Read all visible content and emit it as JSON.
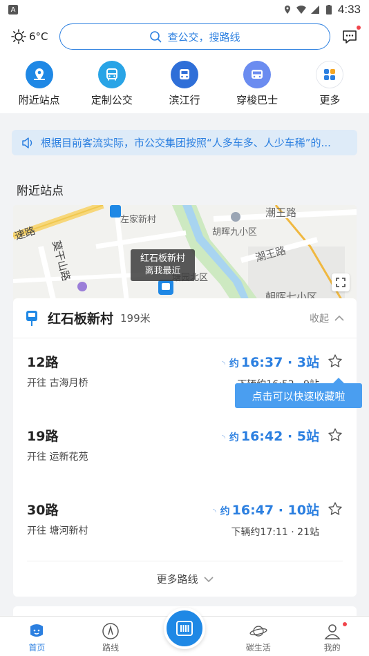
{
  "status_bar": {
    "left_badge": "A",
    "time": "4:33"
  },
  "top_bar": {
    "temperature": "6°C",
    "search_placeholder": "查公交，搜路线"
  },
  "quick_nav": [
    {
      "label": "附近站点",
      "icon": "map-pin-icon",
      "color": "#1f88e5"
    },
    {
      "label": "定制公交",
      "icon": "bus-icon",
      "color": "#29a4e6"
    },
    {
      "label": "滨江行",
      "icon": "bus-front-icon",
      "color": "#2f6fd8"
    },
    {
      "label": "穿梭巴士",
      "icon": "shuttle-bus-icon",
      "color": "#6b8cf0"
    },
    {
      "label": "更多",
      "icon": "grid-icon",
      "color": "#f0f3f8"
    }
  ],
  "notice": {
    "text": "根据目前客流实际，市公交集团按照“人多车多、人少车稀”的..."
  },
  "nearby_title": "附近站点",
  "map": {
    "tooltip_line1": "红石板新村",
    "tooltip_line2": "离我最近",
    "labels": [
      "左家新村",
      "胡晖九小区",
      "潮王路",
      "潮王路",
      "速路",
      "莫干山路",
      "塘园北区",
      "朝晖七小区"
    ]
  },
  "station": {
    "name": "红石板新村",
    "distance": "199米",
    "collapse_label": "收起",
    "routes": [
      {
        "name": "12路",
        "dest": "开往 古海月桥",
        "approx": "约",
        "eta": "16:37 · 3站",
        "next": "下辆约16:52 · 9站"
      },
      {
        "name": "19路",
        "dest": "开往 运新花苑",
        "approx": "约",
        "eta": "16:42 · 5站",
        "next": ""
      },
      {
        "name": "30路",
        "dest": "开往 塘河新村",
        "approx": "约",
        "eta": "16:47 · 10站",
        "next": "下辆约17:11 · 21站"
      }
    ],
    "more_routes": "更多路线"
  },
  "tip": "点击可以快速收藏啦",
  "tabs": [
    {
      "label": "首页",
      "active": true
    },
    {
      "label": "路线",
      "active": false
    },
    {
      "label": "",
      "active": false
    },
    {
      "label": "碳生活",
      "active": false
    },
    {
      "label": "我的",
      "active": false
    }
  ],
  "colors": {
    "accent": "#2b7fe0",
    "notice_bg": "#deebf8",
    "tip_bg": "#4a9ef0",
    "badge_red": "#f0444b"
  }
}
